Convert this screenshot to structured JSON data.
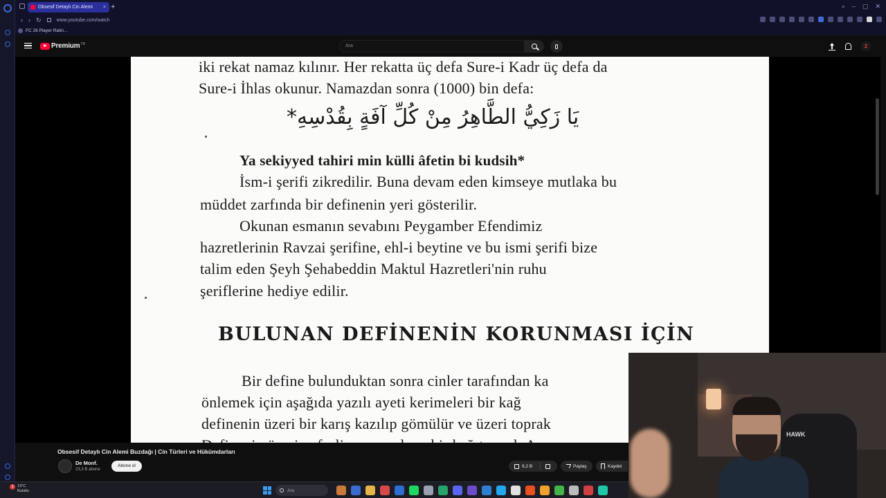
{
  "browser": {
    "tab_title": "Obsesif Detaylı Cin Alemi",
    "tab_close": "×",
    "new_tab": "+",
    "url": "www.youtube.com/watch",
    "bookmark": "FC 26 Player Ratin...",
    "nav": {
      "back": "‹",
      "forward": "›",
      "reload": "↻"
    },
    "window_controls": {
      "search": "⌕",
      "minimize": "–",
      "maximize": "▢",
      "close": "✕"
    }
  },
  "header": {
    "logo_text": "Premium",
    "country": "TR",
    "search_placeholder": "Ara",
    "avatar_letter": "Z"
  },
  "document": {
    "lines": [
      "iki  rekat namaz kılınır. Her rekatta üç defa Sure-i Kadr üç defa da",
      "Sure-i İhlas okunur. Namazdan sonra (1000) bin defa:"
    ],
    "arabic": "يَا زَكِيُّ الطَّاهِرُ مِنْ كُلِّ آفَةٍ بِقُدْسِهِ*",
    "transliteration": "Ya sekiyyed tahiri min külli âfetin bi kudsih*",
    "paragraph2": [
      "İsm-i şerifi zikredilir. Buna devam eden kimseye mutlaka bu",
      "müddet zarfında bir definenin yeri gösterilir."
    ],
    "paragraph3": [
      "Okunan     esmanın     sevabını     Peygamber     Efendimiz",
      "hazretlerinin  Ravzai  şerifine,  ehl-i beytine ve bu ismi şerifi bize",
      "talim   eden   Şeyh   Şehabeddin   Maktul   Hazretleri'nin   ruhu",
      "şeriflerine hediye edilir."
    ],
    "heading": "BULUNAN DEFİNENİN KORUNMASI İÇİN",
    "paragraph4": [
      "Bir   define bulunduktan sonra cinler tarafından ka",
      "önlemek  için  aşağıda  yazılı  ayeti  kerimeleri  bir  kağ",
      "definenin üzeri bir karış kazılıp gömülür ve üzeri toprak",
      "Definenin   üzerine   fesli   ona   yazılmış   bir   kağıt   yazılı   A"
    ]
  },
  "video": {
    "title": "Obsesif Detaylı Cin Alemi Buzdağı | Cin Türleri ve Hükümdarları",
    "channel": "De Monf.",
    "subscribers": "23,3 B abone",
    "subscribe_label": "Abone ol",
    "likes": "9,2 B",
    "share_label": "Paylaş",
    "save_label": "Kaydet",
    "webcam_chair_text": "HAWK"
  },
  "taskbar": {
    "weather_temp": "13°C",
    "weather_desc": "Bulutlu",
    "weather_badge": "3",
    "search_placeholder": "Ara",
    "app_colors": [
      "#c97a3a",
      "#3a6cd0",
      "#e7b44a",
      "#d84848",
      "#2c6fd1",
      "#1ed760",
      "#9aa0b0",
      "#28a36a",
      "#5865f2",
      "#6b4cc8",
      "#2d7fd6",
      "#22a6f0",
      "#e0e0e0",
      "#e8501f",
      "#f0a02c",
      "#44b34a",
      "#bbbbbb",
      "#d14040",
      "#20c7a8"
    ]
  }
}
